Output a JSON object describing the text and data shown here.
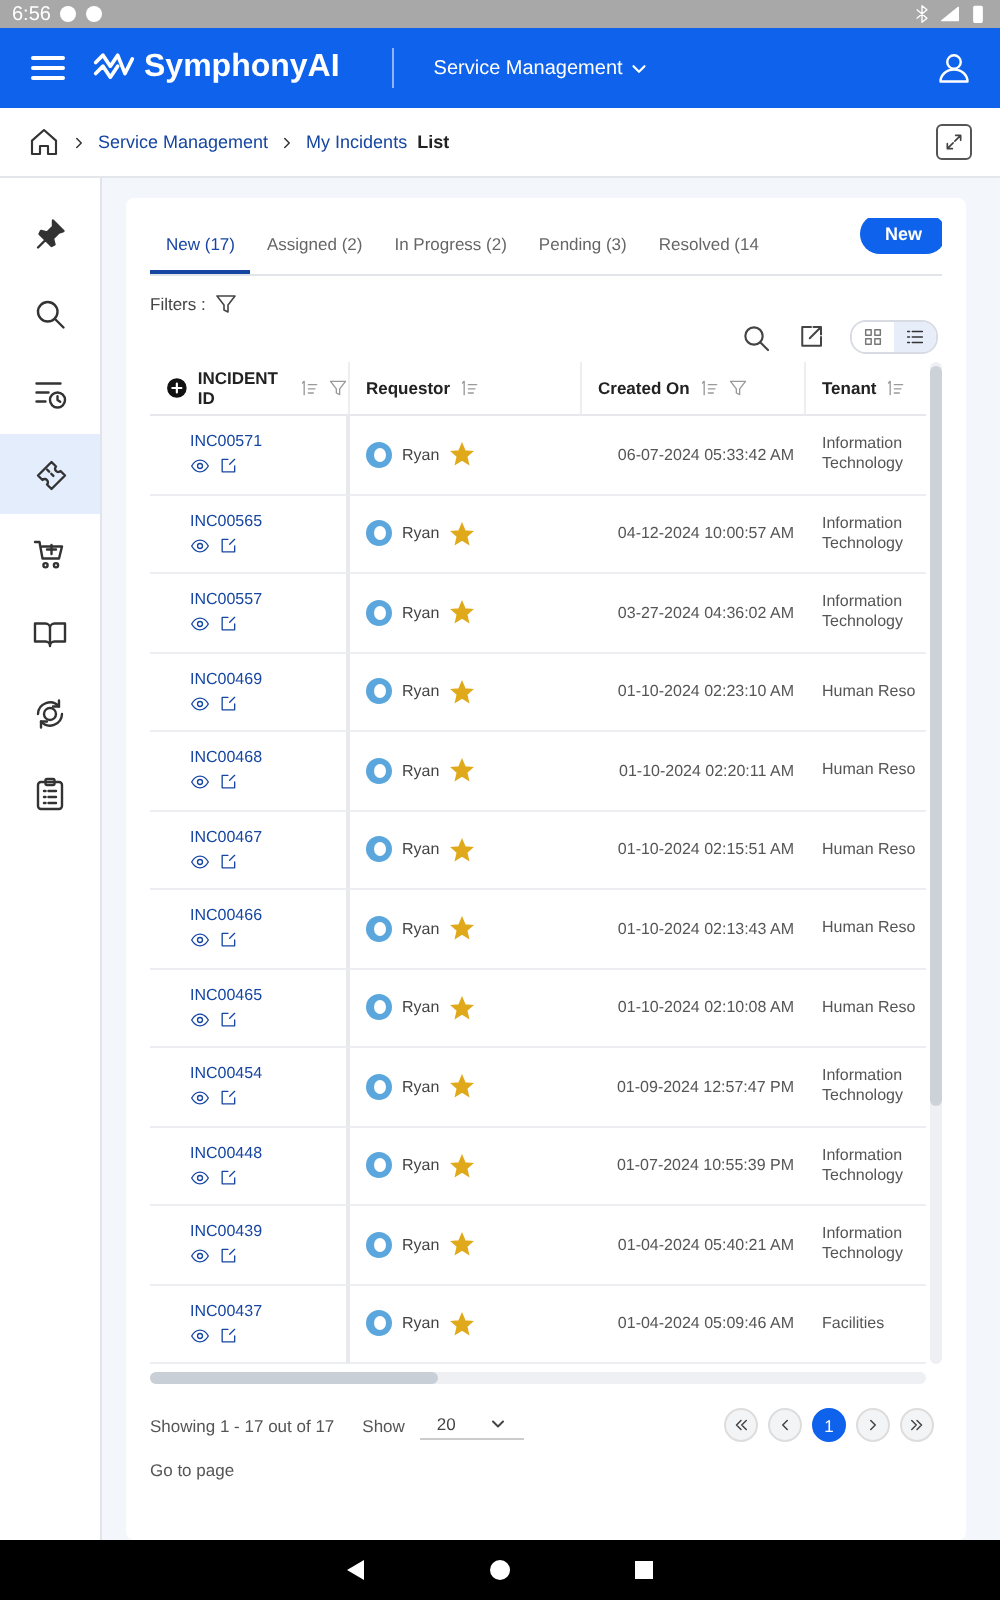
{
  "status_bar": {
    "time": "6:56"
  },
  "header": {
    "brand": "SymphonyAI",
    "module": "Service Management"
  },
  "breadcrumb": {
    "items": [
      "Service Management",
      "My Incidents"
    ],
    "current": "List"
  },
  "sidebar": {
    "items": [
      {
        "kind": "pin",
        "selected": false
      },
      {
        "kind": "search",
        "selected": false
      },
      {
        "kind": "history",
        "selected": false
      },
      {
        "kind": "ticket",
        "selected": true
      },
      {
        "kind": "cart",
        "selected": false
      },
      {
        "kind": "book",
        "selected": false
      },
      {
        "kind": "cycle",
        "selected": false
      },
      {
        "kind": "clipboard",
        "selected": false
      }
    ]
  },
  "tabs": [
    {
      "label": "New (17)",
      "selected": true
    },
    {
      "label": "Assigned (2)",
      "selected": false
    },
    {
      "label": "In Progress (2)",
      "selected": false
    },
    {
      "label": "Pending (3)",
      "selected": false
    },
    {
      "label": "Resolved (14",
      "selected": false
    }
  ],
  "new_button": "New",
  "filters_label": "Filters :",
  "view_toggle": [
    {
      "kind": "grid",
      "selected": false
    },
    {
      "kind": "list",
      "selected": true
    }
  ],
  "table": {
    "columns": [
      "INCIDENT ID",
      "Requestor",
      "Created On",
      "Tenant"
    ],
    "rows": [
      {
        "id": "INC00571",
        "requestor": "Ryan",
        "starred": true,
        "created": "06-07-2024 05:33:42 AM",
        "tenant": "Information Technology"
      },
      {
        "id": "INC00565",
        "requestor": "Ryan",
        "starred": true,
        "created": "04-12-2024 10:00:57 AM",
        "tenant": "Information Technology"
      },
      {
        "id": "INC00557",
        "requestor": "Ryan",
        "starred": true,
        "created": "03-27-2024 04:36:02 AM",
        "tenant": "Information Technology"
      },
      {
        "id": "INC00469",
        "requestor": "Ryan",
        "starred": true,
        "created": "01-10-2024 02:23:10 AM",
        "tenant": "Human Reso"
      },
      {
        "id": "INC00468",
        "requestor": "Ryan",
        "starred": true,
        "created": "01-10-2024 02:20:11 AM",
        "tenant": "Human Reso"
      },
      {
        "id": "INC00467",
        "requestor": "Ryan",
        "starred": true,
        "created": "01-10-2024 02:15:51 AM",
        "tenant": "Human Reso"
      },
      {
        "id": "INC00466",
        "requestor": "Ryan",
        "starred": true,
        "created": "01-10-2024 02:13:43 AM",
        "tenant": "Human Reso"
      },
      {
        "id": "INC00465",
        "requestor": "Ryan",
        "starred": true,
        "created": "01-10-2024 02:10:08 AM",
        "tenant": "Human Reso"
      },
      {
        "id": "INC00454",
        "requestor": "Ryan",
        "starred": true,
        "created": "01-09-2024 12:57:47 PM",
        "tenant": "Information Technology"
      },
      {
        "id": "INC00448",
        "requestor": "Ryan",
        "starred": true,
        "created": "01-07-2024 10:55:39 PM",
        "tenant": "Information Technology"
      },
      {
        "id": "INC00439",
        "requestor": "Ryan",
        "starred": true,
        "created": "01-04-2024 05:40:21 AM",
        "tenant": "Information Technology"
      },
      {
        "id": "INC00437",
        "requestor": "Ryan",
        "starred": true,
        "created": "01-04-2024 05:09:46 AM",
        "tenant": "Facilities"
      }
    ]
  },
  "footer": {
    "summary": "Showing 1 - 17 out of 17",
    "show_label": "Show",
    "page_size": "20",
    "pages": [
      {
        "label": "1",
        "selected": true
      }
    ],
    "goto_label": "Go to page"
  }
}
